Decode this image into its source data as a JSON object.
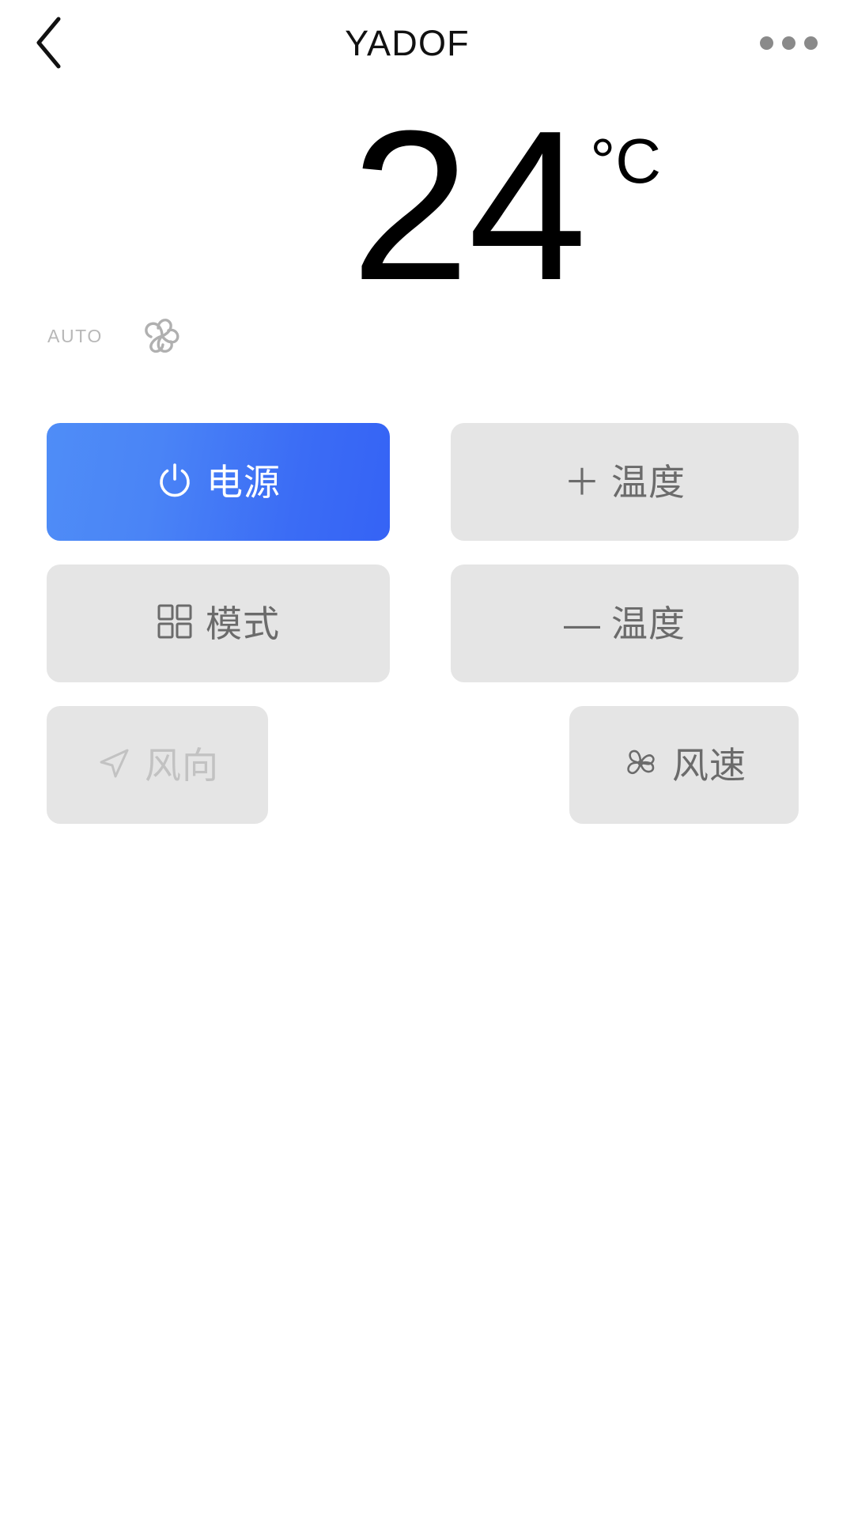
{
  "header": {
    "back_icon": "chevron-left-icon",
    "title": "YADOF",
    "more_icon": "more-horizontal-icon"
  },
  "temperature": {
    "value": "24",
    "unit": "°C"
  },
  "status": {
    "mode_label": "AUTO",
    "mode_icon": "fan-swirl-icon"
  },
  "controls": {
    "power": {
      "label": "电源",
      "icon": "power-icon",
      "state": "active",
      "color": "#3b6cf5"
    },
    "temp_up": {
      "label": "温度",
      "glyph": "＋",
      "icon": "plus-icon",
      "state": "enabled"
    },
    "mode": {
      "label": "模式",
      "icon": "grid-squares-icon",
      "state": "enabled"
    },
    "temp_down": {
      "label": "温度",
      "glyph": "―",
      "icon": "minus-icon",
      "state": "enabled"
    },
    "wind_direction": {
      "label": "风向",
      "icon": "navigation-arrow-icon",
      "state": "disabled"
    },
    "fan_speed": {
      "label": "风速",
      "icon": "fan-blades-icon",
      "state": "enabled"
    }
  },
  "colors": {
    "accent_start": "#4f8df7",
    "accent_end": "#3563f5",
    "button_bg": "#e5e5e5",
    "button_text": "#6b6b6b",
    "button_text_disabled": "#c2c2c2",
    "page_bg": "#ffffff"
  }
}
